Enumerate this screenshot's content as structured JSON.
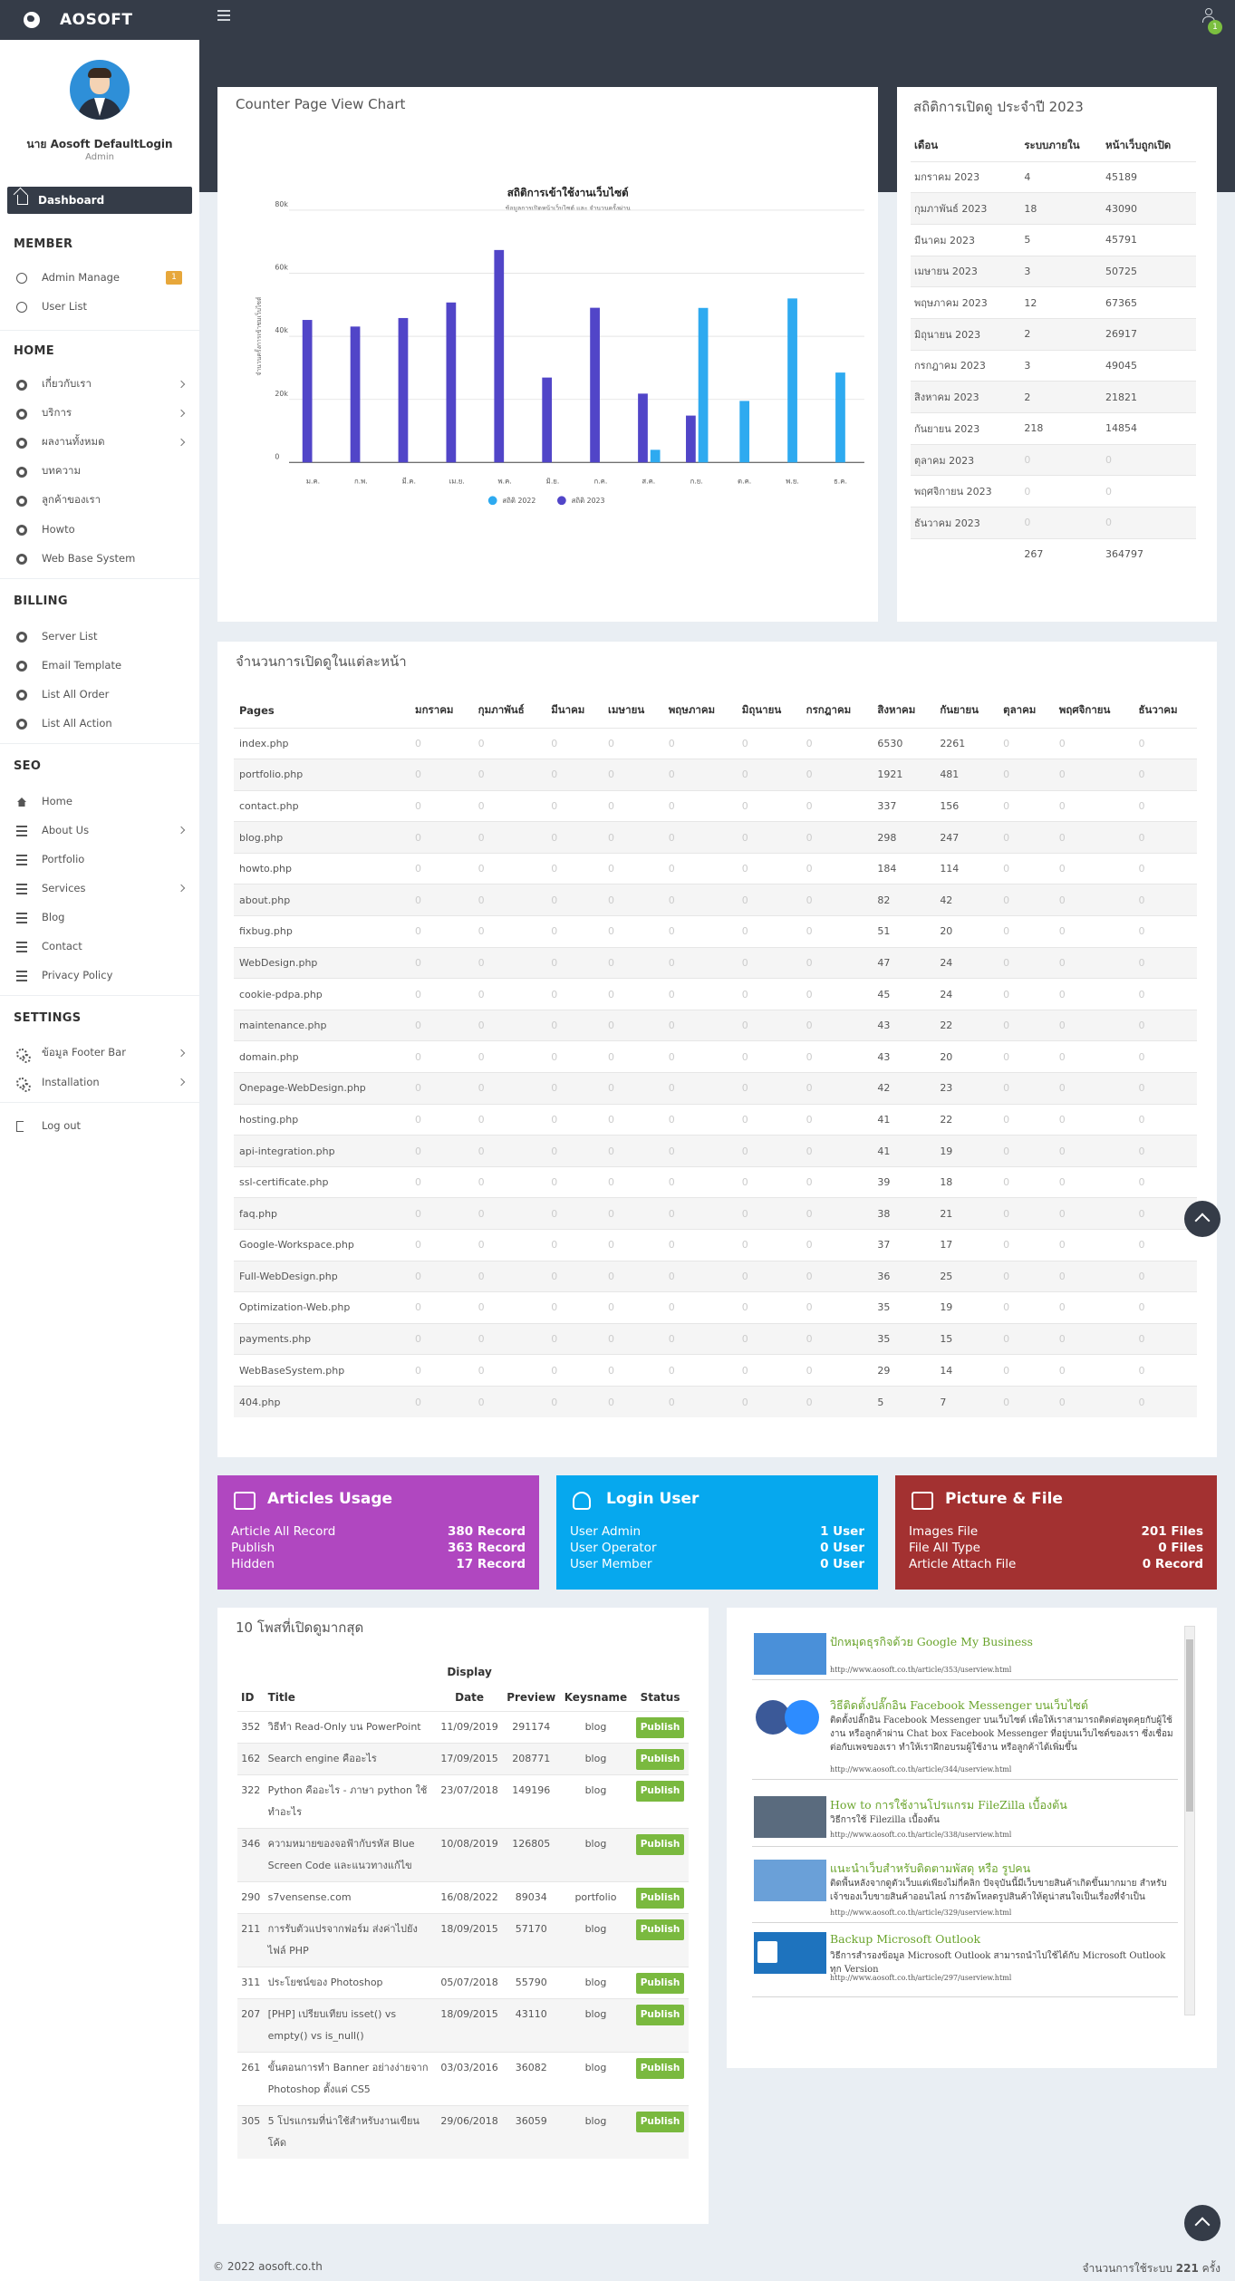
{
  "app": {
    "title": "AOSOFT",
    "notifications": "1"
  },
  "user": {
    "name": "นาย Aosoft DefaultLogin",
    "role": "Admin"
  },
  "sidebar": {
    "dashboard": "Dashboard",
    "member": {
      "title": "MEMBER",
      "items": [
        "Admin Manage",
        "User List"
      ],
      "admin_badge": "1"
    },
    "home": {
      "title": "HOME",
      "items": [
        "เกี่ยวกับเรา",
        "บริการ",
        "ผลงานทั้งหมด",
        "บทความ",
        "ลูกค้าของเรา",
        "Howto",
        "Web Base System"
      ]
    },
    "billing": {
      "title": "BILLING",
      "items": [
        "Server List",
        "Email Template",
        "List All Order",
        "List All Action"
      ]
    },
    "seo": {
      "title": "SEO",
      "items": [
        "Home",
        "About Us",
        "Portfolio",
        "Services",
        "Blog",
        "Contact",
        "Privacy Policy"
      ]
    },
    "settings": {
      "title": "SETTINGS",
      "items": [
        "ข้อมูล Footer Bar",
        "Installation"
      ]
    },
    "logout": "Log out"
  },
  "chart_card": {
    "title": "Counter Page View Chart"
  },
  "chart_data": {
    "type": "bar",
    "title": "สถิติการเข้าใช้งานเว็บไซต์",
    "subtitle": "ข้อมูลการเปิดหน้าเว็บไซต์ และ จำนวนครั้งผ่าน",
    "ylabel": "จำนวนครั้งการเข้าชมเว็บไซต์",
    "xlabel": "",
    "ylim": [
      0,
      80000
    ],
    "yticks": [
      "0",
      "20k",
      "40k",
      "60k",
      "80k"
    ],
    "categories": [
      "ม.ค.",
      "ก.พ.",
      "มี.ค.",
      "เม.ย.",
      "พ.ค.",
      "มิ.ย.",
      "ก.ค.",
      "ส.ค.",
      "ก.ย.",
      "ต.ค.",
      "พ.ย.",
      "ธ.ค."
    ],
    "series": [
      {
        "name": "สถิติ 2022",
        "color": "#2eaaf0",
        "values": [
          0,
          0,
          0,
          0,
          0,
          0,
          0,
          4000,
          49000,
          19500,
          52000,
          28500
        ]
      },
      {
        "name": "สถิติ 2023",
        "color": "#5145c8",
        "values": [
          45189,
          43090,
          45791,
          50725,
          67365,
          26917,
          49045,
          21821,
          14854,
          0,
          0,
          0
        ]
      }
    ],
    "grid": true,
    "legend": "bottom"
  },
  "stats": {
    "title": "สถิติการเปิดดู ประจำปี 2023",
    "headers": [
      "เดือน",
      "ระบบภายใน",
      "หน้าเว็บถูกเปิด"
    ],
    "rows": [
      [
        "มกราคม 2023",
        "4",
        "45189"
      ],
      [
        "กุมภาพันธ์ 2023",
        "18",
        "43090"
      ],
      [
        "มีนาคม 2023",
        "5",
        "45791"
      ],
      [
        "เมษายน 2023",
        "3",
        "50725"
      ],
      [
        "พฤษภาคม 2023",
        "12",
        "67365"
      ],
      [
        "มิถุนายน 2023",
        "2",
        "26917"
      ],
      [
        "กรกฎาคม 2023",
        "3",
        "49045"
      ],
      [
        "สิงหาคม 2023",
        "2",
        "21821"
      ],
      [
        "กันยายน 2023",
        "218",
        "14854"
      ],
      [
        "ตุลาคม 2023",
        "0",
        "0"
      ],
      [
        "พฤศจิกายน 2023",
        "0",
        "0"
      ],
      [
        "ธันวาคม 2023",
        "0",
        "0"
      ],
      [
        "",
        "267",
        "364797"
      ]
    ]
  },
  "pageviews": {
    "title": "จำนวนการเปิดดูในแต่ละหน้า",
    "headers": [
      "Pages",
      "มกราคม",
      "กุมภาพันธ์",
      "มีนาคม",
      "เมษายน",
      "พฤษภาคม",
      "มิถุนายน",
      "กรกฎาคม",
      "สิงหาคม",
      "กันยายน",
      "ตุลาคม",
      "พฤศจิกายน",
      "ธันวาคม"
    ],
    "rows": [
      [
        "index.php",
        "6530",
        "2261"
      ],
      [
        "portfolio.php",
        "1921",
        "481"
      ],
      [
        "contact.php",
        "337",
        "156"
      ],
      [
        "blog.php",
        "298",
        "247"
      ],
      [
        "howto.php",
        "184",
        "114"
      ],
      [
        "about.php",
        "82",
        "42"
      ],
      [
        "fixbug.php",
        "51",
        "20"
      ],
      [
        "WebDesign.php",
        "47",
        "24"
      ],
      [
        "cookie-pdpa.php",
        "45",
        "24"
      ],
      [
        "maintenance.php",
        "43",
        "22"
      ],
      [
        "domain.php",
        "43",
        "20"
      ],
      [
        "Onepage-WebDesign.php",
        "42",
        "23"
      ],
      [
        "hosting.php",
        "41",
        "22"
      ],
      [
        "api-integration.php",
        "41",
        "19"
      ],
      [
        "ssl-certificate.php",
        "39",
        "18"
      ],
      [
        "faq.php",
        "38",
        "21"
      ],
      [
        "Google-Workspace.php",
        "37",
        "17"
      ],
      [
        "Full-WebDesign.php",
        "36",
        "25"
      ],
      [
        "Optimization-Web.php",
        "35",
        "19"
      ],
      [
        "payments.php",
        "35",
        "15"
      ],
      [
        "WebBaseSystem.php",
        "29",
        "14"
      ],
      [
        "404.php",
        "5",
        "7"
      ]
    ]
  },
  "boxes": [
    {
      "title": "Articles Usage",
      "rows": [
        [
          "Article All Record",
          "380 Record"
        ],
        [
          "Publish",
          "363 Record"
        ],
        [
          "Hidden",
          "17 Record"
        ]
      ],
      "color": "#b047c0"
    },
    {
      "title": "Login User",
      "rows": [
        [
          "User Admin",
          "1 User"
        ],
        [
          "User Operator",
          "0 User"
        ],
        [
          "User Member",
          "0 User"
        ]
      ],
      "color": "#06a8ee"
    },
    {
      "title": "Picture & File",
      "rows": [
        [
          "Images File",
          "201 Files"
        ],
        [
          "File All Type",
          "0 Files"
        ],
        [
          "Article Attach File",
          "0 Record"
        ]
      ],
      "color": "#a33131"
    }
  ],
  "top_posts": {
    "title": "10 โพสที่เปิดดูมากสุด",
    "headers": {
      "id": "ID",
      "title": "Title",
      "display": "Display",
      "date": "Date",
      "preview": "Preview",
      "keysname": "Keysname",
      "status": "Status"
    },
    "rows": [
      {
        "id": "352",
        "title": "วิธีทำ Read-Only บน PowerPoint",
        "date": "11/09/2019",
        "preview": "291174",
        "key": "blog",
        "status": "Publish"
      },
      {
        "id": "162",
        "title": "Search engine คืออะไร",
        "date": "17/09/2015",
        "preview": "208771",
        "key": "blog",
        "status": "Publish"
      },
      {
        "id": "322",
        "title": "Python คืออะไร - ภาษา python ใช้ทำอะไร",
        "date": "23/07/2018",
        "preview": "149196",
        "key": "blog",
        "status": "Publish"
      },
      {
        "id": "346",
        "title": "ความหมายของจอฟ้ากับรหัส Blue Screen Code และแนวทางแก้ไข",
        "date": "10/08/2019",
        "preview": "126805",
        "key": "blog",
        "status": "Publish"
      },
      {
        "id": "290",
        "title": "s7vensense.com",
        "date": "16/08/2022",
        "preview": "89034",
        "key": "portfolio",
        "status": "Publish"
      },
      {
        "id": "211",
        "title": "การรับตัวแปรจากฟอร์ม ส่งค่าไปยังไฟล์ PHP",
        "date": "18/09/2015",
        "preview": "57170",
        "key": "blog",
        "status": "Publish"
      },
      {
        "id": "311",
        "title": "ประโยชน์ของ Photoshop",
        "date": "05/07/2018",
        "preview": "55790",
        "key": "blog",
        "status": "Publish"
      },
      {
        "id": "207",
        "title": "[PHP] เปรียบเทียบ isset() vs empty() vs is_null()",
        "date": "18/09/2015",
        "preview": "43110",
        "key": "blog",
        "status": "Publish"
      },
      {
        "id": "261",
        "title": "ขั้นตอนการทำ Banner อย่างง่ายจาก Photoshop ตั้งแต่ CS5",
        "date": "03/03/2016",
        "preview": "36082",
        "key": "blog",
        "status": "Publish"
      },
      {
        "id": "305",
        "title": "5 โปรแกรมที่น่าใช้สำหรับงานเขียนโค้ด",
        "date": "29/06/2018",
        "preview": "36059",
        "key": "blog",
        "status": "Publish"
      }
    ]
  },
  "feed": [
    {
      "title": "ปักหมุดธุรกิจด้วย Google My Business",
      "desc": "",
      "url": "http://www.aosoft.co.th/article/353/userview.html"
    },
    {
      "title": "วิธีติดตั้งปลั๊กอิน Facebook Messenger บนเว็บไซต์",
      "desc": "ติดตั้งปลั๊กอิน Facebook Messenger บนเว็บไซต์ เพื่อให้เราสามารถติดต่อพูดคุยกับผู้ใช้งาน หรือลูกค้าผ่าน Chat box Facebook Messenger ที่อยู่บนเว็บไซต์ของเรา ซึ่งเชื่อมต่อกับเพจของเรา ทำให้เราฝึกอบรมผู้ใช้งาน หรือลูกค้าได้เพิ่มขึ้น",
      "url": "http://www.aosoft.co.th/article/344/userview.html"
    },
    {
      "title": "How to การใช้งานโปรแกรม FileZilla เบื้องต้น",
      "desc": "วิธีการใช้ Filezilla เบื้องต้น",
      "url": "http://www.aosoft.co.th/article/338/userview.html"
    },
    {
      "title": "แนะนำเว็บสำหรับติดตามพัสดุ หรือ รูปคน",
      "desc": "ติดพื้นหลังจากดูตัวเว็บแต่เพียงไม่กี่คลิก ปัจจุบันนี้มีเว็บขายสินค้าเกิดขึ้นมากมาย สำหรับเจ้าของเว็บขายสินค้าออนไลน์ การอัพโหลดรูปสินค้าให้ดูน่าสนใจเป็นเรื่องที่จำเป็น",
      "url": "http://www.aosoft.co.th/article/329/userview.html"
    },
    {
      "title": "Backup Microsoft Outlook",
      "desc": "วิธีการสำรองข้อมูล Microsoft Outlook สามารถนำไปใช้ได้กับ Microsoft Outlook ทุก Version",
      "url": "http://www.aosoft.co.th/article/297/userview.html"
    }
  ],
  "footer": {
    "copyright": "© 2022 aosoft.co.th",
    "usage_label": "จำนวนการใช้ระบบ",
    "usage_count": "221",
    "usage_unit": "ครั้ง"
  }
}
